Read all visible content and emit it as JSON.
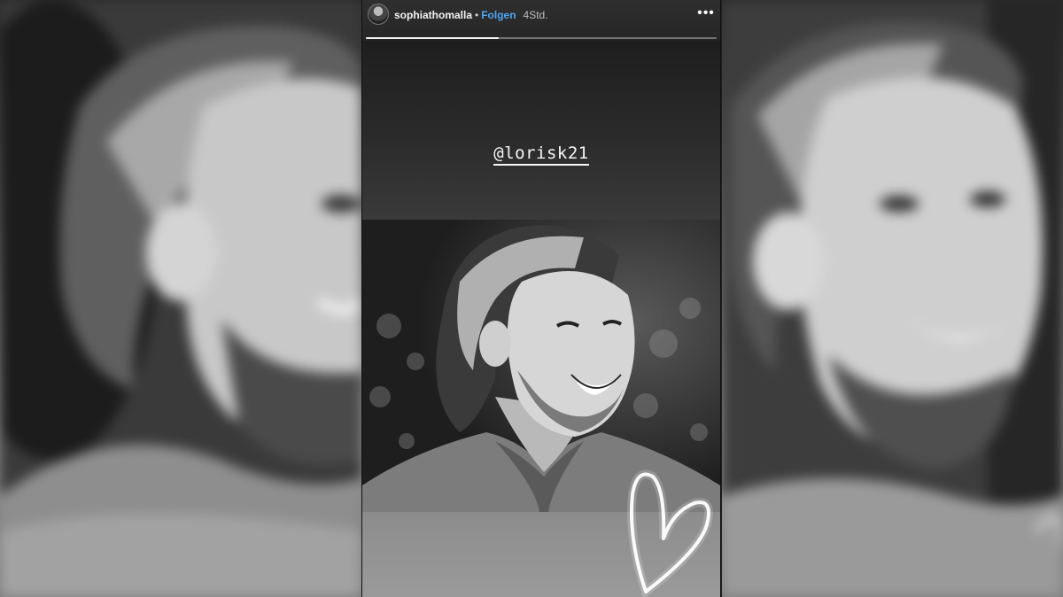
{
  "story": {
    "username": "sophiathomalla",
    "separator": "•",
    "follow_label": "Folgen",
    "timestamp": "4Std.",
    "more_icon": "more-horizontal-icon",
    "mention_text": "@lorisk21",
    "progress": 0.38
  },
  "colors": {
    "follow": "#4ea6f5",
    "header_bg": "#2f2f2f",
    "text": "#ffffff"
  }
}
